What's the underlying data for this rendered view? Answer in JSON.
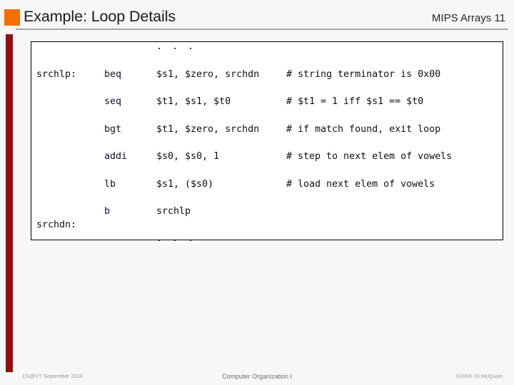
{
  "header": {
    "title": "Example: Loop Details",
    "section_label": "MIPS Arrays 11",
    "square_color": "#F37000",
    "rule_color": "#A6A6A6"
  },
  "accent_bar": {
    "color": "#8B1111"
  },
  "code_block": {
    "border_color": "#000000",
    "background": "#FFFFFF",
    "text_color": "#111133",
    "rows": [
      {
        "label": "",
        "mnemonic": "",
        "operands": ". . .",
        "comment": ""
      },
      {
        "label": "srchlp:",
        "mnemonic": "beq",
        "operands": "$s1, $zero, srchdn",
        "comment": "# string terminator is 0x00"
      },
      {
        "label": "",
        "mnemonic": "seq",
        "operands": "$t1, $s1, $t0",
        "comment": "# $t1 = 1 iff $s1 == $t0"
      },
      {
        "label": "",
        "mnemonic": "bgt",
        "operands": "$t1, $zero, srchdn",
        "comment": "# if match found, exit loop"
      },
      {
        "label": "",
        "mnemonic": "addi",
        "operands": "$s0, $s0, 1",
        "comment": "# step to next elem of vowels"
      },
      {
        "label": "",
        "mnemonic": "lb",
        "operands": "$s1, ($s0)",
        "comment": "# load next elem of vowels"
      },
      {
        "label": "",
        "mnemonic": "b",
        "operands": "srchlp",
        "comment": ""
      },
      {
        "label": "srchdn:",
        "mnemonic": "",
        "operands": "",
        "comment": ""
      },
      {
        "label": "",
        "mnemonic": "",
        "operands": ". . .",
        "comment": ""
      }
    ]
  },
  "footer": {
    "left": "CS@VT September 2010",
    "center": "Computer Organization I",
    "right": "©2006-10  McQuain."
  }
}
